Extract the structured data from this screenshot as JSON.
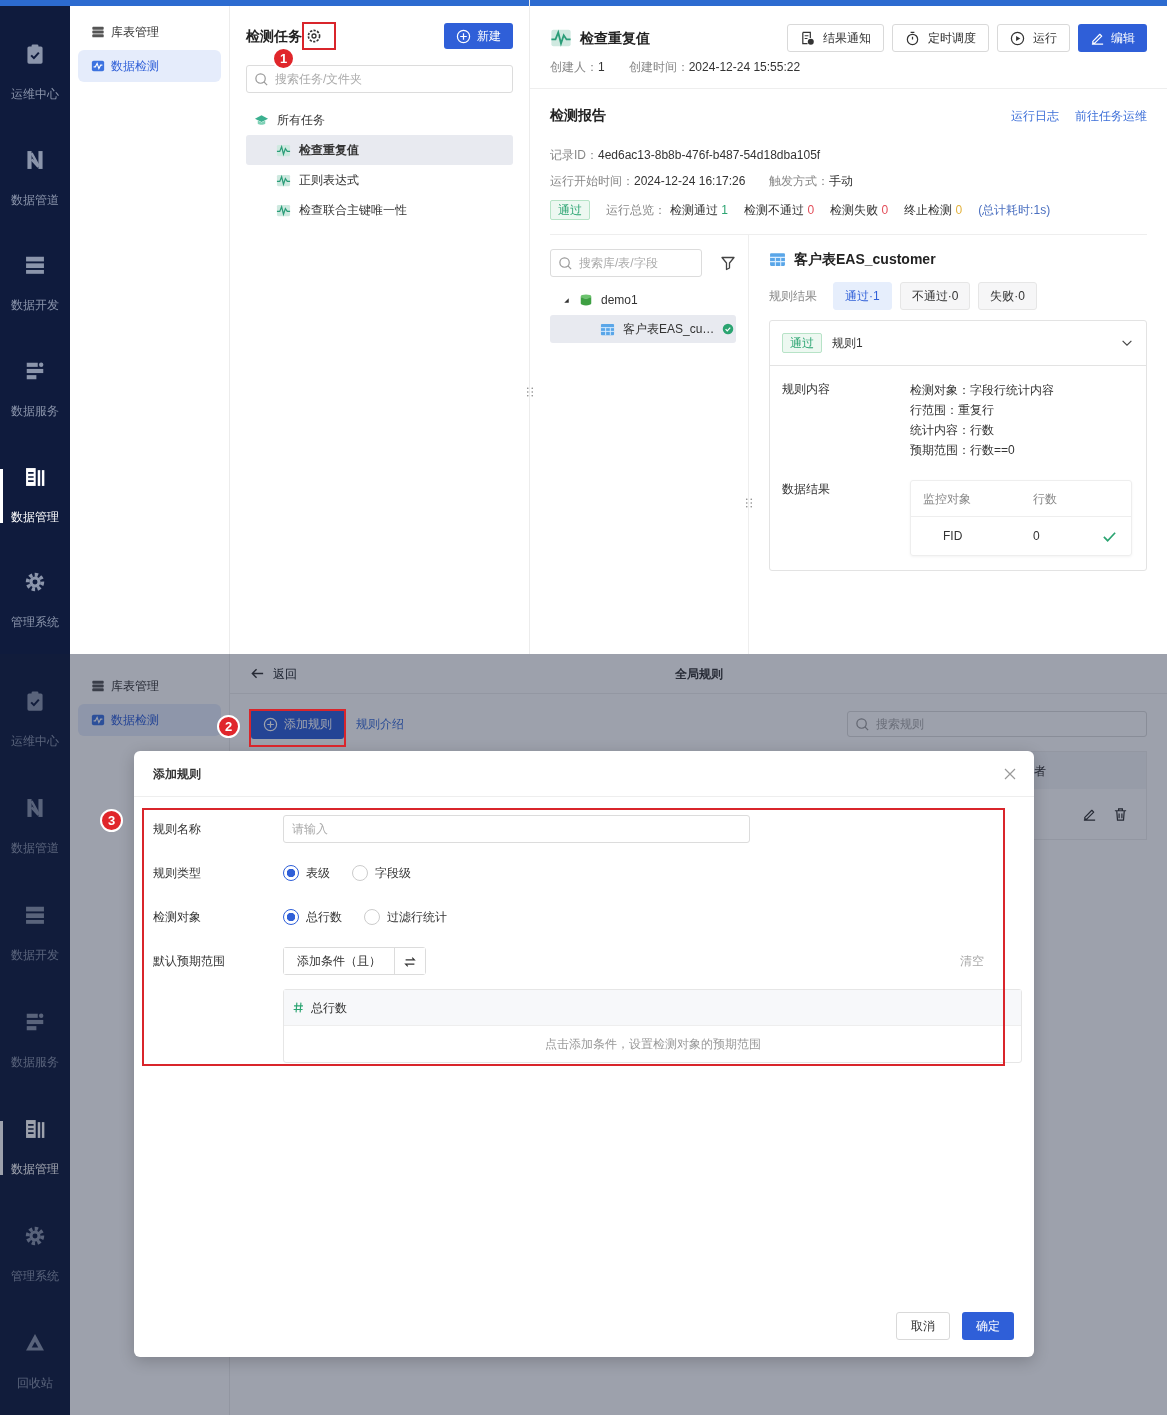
{
  "top_screen": {
    "rail": [
      {
        "label": "运维中心",
        "selected": false
      },
      {
        "label": "数据管道",
        "selected": false
      },
      {
        "label": "数据开发",
        "selected": false
      },
      {
        "label": "数据服务",
        "selected": false
      },
      {
        "label": "数据管理",
        "selected": true
      },
      {
        "label": "管理系统",
        "selected": false
      }
    ],
    "sidebar": [
      {
        "label": "库表管理",
        "selected": false
      },
      {
        "label": "数据检测",
        "selected": true
      }
    ],
    "task_panel": {
      "title": "检测任务",
      "new_button": "新建",
      "search": {
        "placeholder": "搜索任务/文件夹"
      },
      "tree": {
        "label": "所有任务",
        "children": [
          {
            "label": "检查重复值",
            "selected": true
          },
          {
            "label": "正则表达式",
            "selected": false
          },
          {
            "label": "检查联合主键唯一性",
            "selected": false
          }
        ]
      }
    },
    "detail": {
      "title": "检查重复值",
      "buttons": [
        {
          "label": "结果通知",
          "kind": "outline"
        },
        {
          "label": "定时调度",
          "kind": "outline"
        },
        {
          "label": "运行",
          "kind": "outline"
        },
        {
          "label": "编辑",
          "kind": "primary"
        }
      ],
      "meta": [
        {
          "label": "创建人：",
          "value": "1"
        },
        {
          "label": "创建时间：",
          "value": "2024-12-24 15:55:22"
        }
      ],
      "report": {
        "title": "检测报告",
        "links": [
          "运行日志",
          "前往任务运维"
        ],
        "info_rows": [
          [
            {
              "label": "记录ID：",
              "value": "4ed6ac13-8b8b-476f-b487-54d18dba105f"
            }
          ],
          [
            {
              "label": "运行开始时间：",
              "value": "2024-12-24 16:17:26"
            },
            {
              "label": "触发方式：",
              "value": "手动"
            }
          ]
        ],
        "status_badge": "通过",
        "summary_label": "运行总览：",
        "summary": [
          {
            "label": "检测通过",
            "value": "1",
            "color": "#2ba471"
          },
          {
            "label": "检测不通过",
            "value": "0",
            "color": "#e34d59"
          },
          {
            "label": "检测失败",
            "value": "0",
            "color": "#e34d59"
          },
          {
            "label": "终止检测",
            "value": "0",
            "color": "#e3b23c"
          }
        ],
        "duration": "(总计耗时:1s)",
        "table_search": {
          "placeholder": "搜索库/表/字段"
        },
        "tree": {
          "label": "demo1",
          "expanded": true,
          "children": [
            {
              "label": "客户表EAS_cu…",
              "selected": true,
              "passed": true
            }
          ]
        },
        "result": {
          "title": "客户表EAS_customer",
          "filter_label": "规则结果",
          "filters": [
            {
              "label": "通过·1",
              "selected": true
            },
            {
              "label": "不通过·0",
              "selected": false
            },
            {
              "label": "失败·0",
              "selected": false
            }
          ],
          "rules": [
            {
              "status": "通过",
              "name": "规则1",
              "expanded": true,
              "content_label": "规则内容",
              "content": [
                "检测对象：字段行统计内容",
                "行范围：重复行",
                "统计内容：行数",
                "预期范围：行数==0"
              ],
              "data_label": "数据结果",
              "columns": [
                "监控对象",
                "行数"
              ],
              "rows": [
                {
                  "cells": [
                    "FID",
                    "0"
                  ],
                  "passed": true
                }
              ]
            }
          ]
        }
      }
    }
  },
  "bottom_screen": {
    "rail": [
      {
        "label": "运维中心",
        "selected": false
      },
      {
        "label": "数据管道",
        "selected": false
      },
      {
        "label": "数据开发",
        "selected": false
      },
      {
        "label": "数据服务",
        "selected": false
      },
      {
        "label": "数据管理",
        "selected": true
      },
      {
        "label": "管理系统",
        "selected": false
      },
      {
        "label": "回收站",
        "selected": false
      }
    ],
    "sidebar": [
      {
        "label": "库表管理",
        "selected": false
      },
      {
        "label": "数据检测",
        "selected": true
      }
    ],
    "header": {
      "back": "返回",
      "title": "全局规则"
    },
    "toolbar": {
      "add_button": "添加规则",
      "intro_link": "规则介绍",
      "search": {
        "placeholder": "搜索规则"
      }
    },
    "table": {
      "column_partial": "者"
    },
    "modal": {
      "title": "添加规则",
      "fields": [
        {
          "kind": "text",
          "label": "规则名称",
          "placeholder": "请输入"
        },
        {
          "kind": "radio",
          "label": "规则类型",
          "options": [
            {
              "label": "表级",
              "selected": true
            },
            {
              "label": "字段级",
              "selected": false
            }
          ]
        },
        {
          "kind": "radio",
          "label": "检测对象",
          "options": [
            {
              "label": "总行数",
              "selected": true
            },
            {
              "label": "过滤行统计",
              "selected": false
            }
          ]
        },
        {
          "kind": "range",
          "label": "默认预期范围",
          "add_button": "添加条件（且）",
          "clear_link": "清空",
          "clear_disabled": true,
          "target": "总行数",
          "hint": "点击添加条件，设置检测对象的预期范围"
        }
      ],
      "buttons": [
        {
          "label": "取消",
          "kind": "secondary"
        },
        {
          "label": "确定",
          "kind": "primary"
        }
      ]
    }
  },
  "annotations": [
    {
      "number": "1"
    },
    {
      "number": "2"
    },
    {
      "number": "3"
    }
  ]
}
